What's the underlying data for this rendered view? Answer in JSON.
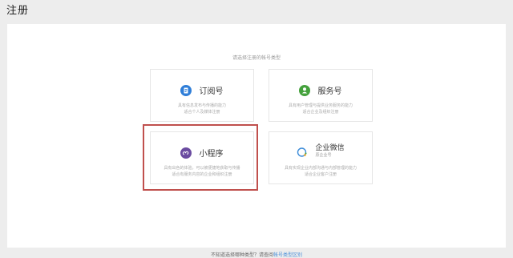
{
  "page": {
    "title": "注册"
  },
  "panel": {
    "subtitle": "请选择注册的帐号类型"
  },
  "cards": [
    {
      "name": "订阅号",
      "desc1": "具有信息发布与传播的能力",
      "desc2": "适合个人及媒体注册",
      "icon_color": "#2f7ed8"
    },
    {
      "name": "服务号",
      "desc1": "具有用户管理与提供业务服务的能力",
      "desc2": "适合企业及组织注册",
      "icon_color": "#44a13c"
    },
    {
      "name": "小程序",
      "desc1": "具有出色的体验，可以被便捷地获取与传播",
      "desc2": "适合有服务内容的企业和组织注册",
      "icon_color": "#6a4ba0"
    },
    {
      "name": "企业微信",
      "sub": "原企业号",
      "desc1": "具有实现企业内部沟通与内部管理的能力",
      "desc2": "适合企业客户注册",
      "icon_color": "#3a8bd8"
    }
  ],
  "footer": {
    "text": "不知道选择哪种类型？请查阅",
    "link": "帐号类型区别"
  }
}
